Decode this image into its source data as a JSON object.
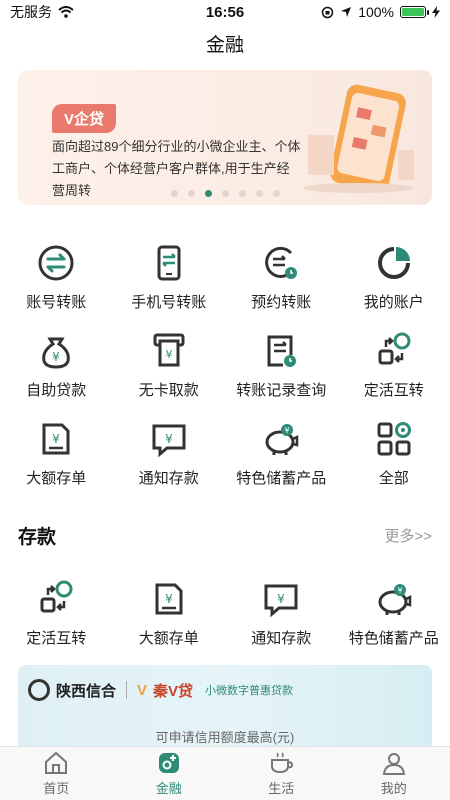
{
  "status": {
    "carrier": "无服务",
    "time": "16:56",
    "battery": "100%"
  },
  "header": {
    "title": "金融"
  },
  "banner": {
    "tag": "V企贷",
    "description": "面向超过89个细分行业的小微企业主、个体工商户、个体经营户客户群体,用于生产经营周转",
    "dot_count": 7,
    "active_dot": 2
  },
  "quick_grid": [
    {
      "label": "账号转账",
      "icon": "transfer-icon"
    },
    {
      "label": "手机号转账",
      "icon": "phone-transfer-icon"
    },
    {
      "label": "预约转账",
      "icon": "scheduled-transfer-icon"
    },
    {
      "label": "我的账户",
      "icon": "account-pie-icon"
    },
    {
      "label": "自助贷款",
      "icon": "loan-bag-icon"
    },
    {
      "label": "无卡取款",
      "icon": "cardless-withdraw-icon"
    },
    {
      "label": "转账记录查询",
      "icon": "transfer-record-icon"
    },
    {
      "label": "定活互转",
      "icon": "fixed-current-swap-icon"
    },
    {
      "label": "大额存单",
      "icon": "large-deposit-icon"
    },
    {
      "label": "通知存款",
      "icon": "notice-deposit-icon"
    },
    {
      "label": "特色储蓄产品",
      "icon": "piggy-bank-icon"
    },
    {
      "label": "全部",
      "icon": "all-grid-icon"
    }
  ],
  "deposit": {
    "title": "存款",
    "more": "更多>>",
    "items": [
      {
        "label": "定活互转",
        "icon": "fixed-current-swap-icon"
      },
      {
        "label": "大额存单",
        "icon": "large-deposit-icon"
      },
      {
        "label": "通知存款",
        "icon": "notice-deposit-icon"
      },
      {
        "label": "特色储蓄产品",
        "icon": "piggy-bank-icon"
      }
    ]
  },
  "promo": {
    "brand": "陕西信合",
    "product": "秦V贷",
    "subtitle": "小微数字普惠贷款",
    "note": "可申请信用额度最高(元)"
  },
  "tabs": [
    {
      "label": "首页",
      "icon": "home-icon"
    },
    {
      "label": "金融",
      "icon": "finance-icon"
    },
    {
      "label": "生活",
      "icon": "coffee-cup-icon"
    },
    {
      "label": "我的",
      "icon": "profile-icon"
    }
  ],
  "colors": {
    "accent": "#2e8b76",
    "icon_dark": "#333333",
    "tag": "#e9796a"
  }
}
